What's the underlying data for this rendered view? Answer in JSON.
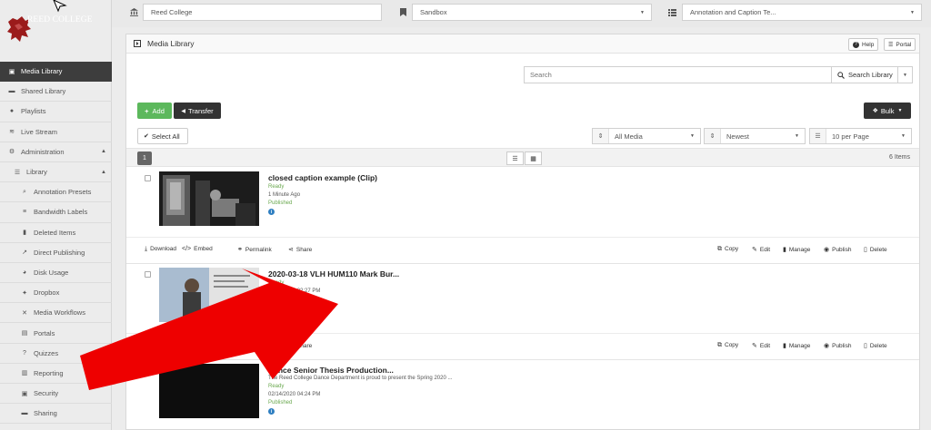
{
  "logo": {
    "text": "REED COLLEGE"
  },
  "sidebar": {
    "items": [
      {
        "label": "Media Library",
        "icon": "▣",
        "level": 0,
        "active": true,
        "name": "sidebar-item-media-library"
      },
      {
        "label": "Shared Library",
        "icon": "▬",
        "level": 0,
        "name": "sidebar-item-shared-library"
      },
      {
        "label": "Playlists",
        "icon": "●",
        "level": 0,
        "name": "sidebar-item-playlists"
      },
      {
        "label": "Live Stream",
        "icon": "≋",
        "level": 0,
        "name": "sidebar-item-live-stream"
      },
      {
        "label": "Administration",
        "icon": "⚙",
        "level": 0,
        "caret": "▲",
        "name": "sidebar-item-administration"
      },
      {
        "label": "Library",
        "icon": "☰",
        "level": 1,
        "caret": "▲",
        "name": "sidebar-item-library"
      },
      {
        "label": "Annotation Presets",
        "icon": "⌕",
        "level": 2,
        "name": "sidebar-item-annotation-presets"
      },
      {
        "label": "Bandwidth Labels",
        "icon": "≡",
        "level": 2,
        "name": "sidebar-item-bandwidth-labels"
      },
      {
        "label": "Deleted Items",
        "icon": "▮",
        "level": 2,
        "name": "sidebar-item-deleted-items"
      },
      {
        "label": "Direct Publishing",
        "icon": "↗",
        "level": 2,
        "name": "sidebar-item-direct-publishing"
      },
      {
        "label": "Disk Usage",
        "icon": "◕",
        "level": 2,
        "name": "sidebar-item-disk-usage"
      },
      {
        "label": "Dropbox",
        "icon": "✦",
        "level": 2,
        "name": "sidebar-item-dropbox"
      },
      {
        "label": "Media Workflows",
        "icon": "✕",
        "level": 2,
        "name": "sidebar-item-media-workflows"
      },
      {
        "label": "Portals",
        "icon": "▤",
        "level": 2,
        "name": "sidebar-item-portals"
      },
      {
        "label": "Quizzes",
        "icon": "?",
        "level": 2,
        "name": "sidebar-item-quizzes"
      },
      {
        "label": "Reporting",
        "icon": "▥",
        "level": 2,
        "name": "sidebar-item-reporting"
      },
      {
        "label": "Security",
        "icon": "▣",
        "level": 2,
        "name": "sidebar-item-security"
      },
      {
        "label": "Sharing",
        "icon": "▬",
        "level": 2,
        "name": "sidebar-item-sharing"
      }
    ]
  },
  "topbar": {
    "institution": "Reed College",
    "environment": "Sandbox",
    "project": "Annotation and Caption Te..."
  },
  "panel": {
    "title": "Media Library",
    "help_label": "Help",
    "portal_label": "Portal"
  },
  "search": {
    "placeholder": "Search",
    "button_label": "Search Library"
  },
  "toolbar": {
    "add_label": "Add",
    "transfer_label": "Transfer",
    "bulk_label": "Bulk",
    "select_all_label": "Select All",
    "filter_media": "All Media",
    "sort_order": "Newest",
    "per_page": "10 per Page"
  },
  "pager": {
    "current_page": "1",
    "items_count": "6 Items"
  },
  "action_labels": {
    "download": "Download",
    "embed": "Embed",
    "permalink": "Permalink",
    "share": "Share",
    "copy": "Copy",
    "edit": "Edit",
    "manage": "Manage",
    "publish": "Publish",
    "delete": "Delete"
  },
  "media_items": [
    {
      "title": "closed caption example (Clip)",
      "description": "",
      "status": "Ready",
      "date": "1 Minute Ago",
      "published": "Published"
    },
    {
      "title": "2020-03-18 VLH HUM110 Mark Bur...",
      "description": "",
      "status": "Ready",
      "date": "03/17/2020 02:27 PM",
      "published": "Published"
    },
    {
      "title": "Dance Senior Thesis Production...",
      "description": "The Reed College Dance Department is proud to present the Spring 2020 ...",
      "status": "Ready",
      "date": "02/14/2020 04:24 PM",
      "published": "Published"
    }
  ],
  "colors": {
    "add_green": "#5cb85c",
    "dark_button": "#333333",
    "status_green": "#6aa84f",
    "info_blue": "#2f7fc1",
    "overlay_arrow": "#ee0000",
    "logo_red": "#9b1b1b"
  },
  "icons": {
    "institution": "university-icon",
    "environment": "bookmark-icon",
    "project": "list-icon",
    "panel": "media-icon",
    "help": "question-icon",
    "portal": "portal-icon"
  }
}
